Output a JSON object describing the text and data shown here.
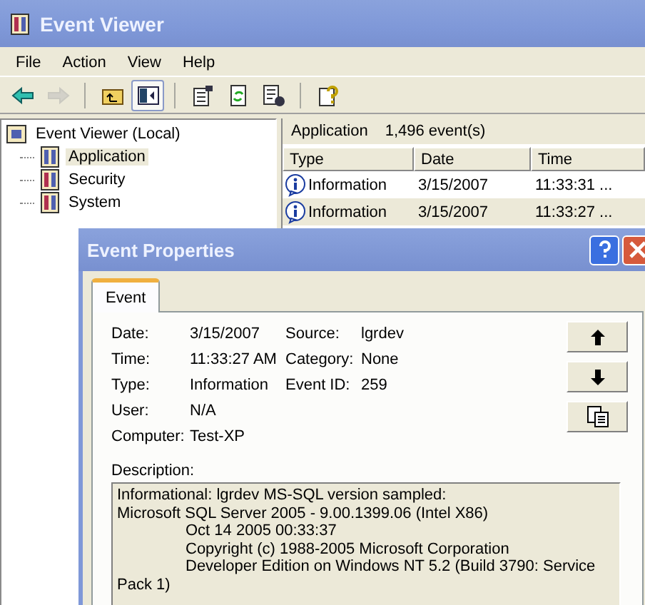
{
  "window": {
    "title": "Event Viewer"
  },
  "menu": [
    "File",
    "Action",
    "View",
    "Help"
  ],
  "toolbar": [
    {
      "kind": "back",
      "disabled": false,
      "pressed": false
    },
    {
      "kind": "forward",
      "disabled": true,
      "pressed": false
    },
    {
      "kind": "sep"
    },
    {
      "kind": "up",
      "disabled": false,
      "pressed": false
    },
    {
      "kind": "tree",
      "disabled": false,
      "pressed": true
    },
    {
      "kind": "sep"
    },
    {
      "kind": "properties",
      "disabled": false,
      "pressed": false
    },
    {
      "kind": "refresh",
      "disabled": false,
      "pressed": false
    },
    {
      "kind": "export",
      "disabled": false,
      "pressed": false
    },
    {
      "kind": "sep"
    },
    {
      "kind": "help",
      "disabled": false,
      "pressed": false
    }
  ],
  "tree": {
    "label": "Event Viewer (Local)",
    "selected": false,
    "children": [
      {
        "label": "Application",
        "selected": true
      },
      {
        "label": "Security",
        "selected": false
      },
      {
        "label": "System",
        "selected": false
      }
    ]
  },
  "list": {
    "title": "Application",
    "count": "1,496 event(s)",
    "columns": [
      "Type",
      "Date",
      "Time"
    ],
    "rows": [
      {
        "type": "Information",
        "date": "3/15/2007",
        "time": "11:33:31 ...",
        "selected": false
      },
      {
        "type": "Information",
        "date": "3/15/2007",
        "time": "11:33:27 ...",
        "selected": true
      }
    ]
  },
  "dialog": {
    "title": "Event Properties",
    "tabs": [
      {
        "label": "Event",
        "selected": true
      }
    ],
    "fields": [
      [
        {
          "label": "Date:",
          "value": "3/15/2007"
        },
        {
          "label": "Source:",
          "value": "lgrdev"
        }
      ],
      [
        {
          "label": "Time:",
          "value": "11:33:27 AM"
        },
        {
          "label": "Category:",
          "value": "None"
        }
      ],
      [
        {
          "label": "Type:",
          "value": "Information"
        },
        {
          "label": "Event ID:",
          "value": "259"
        }
      ],
      [
        {
          "label": "User:",
          "value": "N/A"
        }
      ],
      [
        {
          "label": "Computer:",
          "value": "Test-XP"
        }
      ]
    ],
    "buttons": [
      {
        "kind": "up"
      },
      {
        "kind": "down"
      },
      {
        "kind": "copy"
      }
    ],
    "description_label": "Description:",
    "description": [
      {
        "text": "Informational: lgrdev MS-SQL version sampled:",
        "indented": false
      },
      {
        "text": "Microsoft SQL Server 2005 - 9.00.1399.06 (Intel X86)",
        "indented": false
      },
      {
        "text": "Oct 14 2005 00:33:37",
        "indented": true
      },
      {
        "text": "Copyright (c) 1988-2005 Microsoft Corporation",
        "indented": true
      },
      {
        "text": "Developer Edition on Windows NT 5.2 (Build 3790: Service",
        "indented": true
      },
      {
        "text": "Pack 1)",
        "indented": false
      }
    ]
  }
}
